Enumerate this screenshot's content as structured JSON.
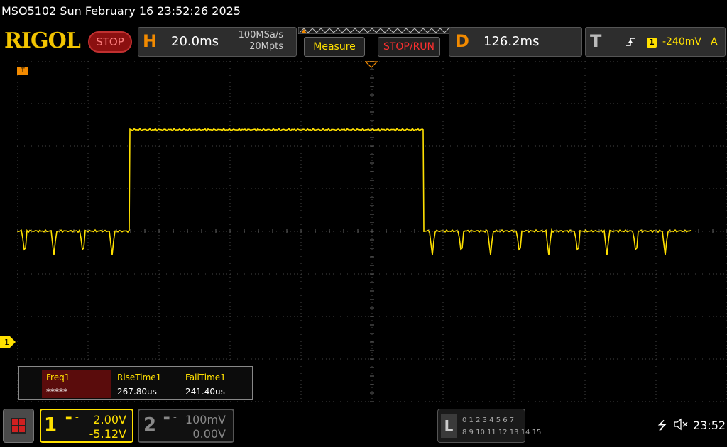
{
  "title_bar": "MSO5102  Sun February 16 23:52:26 2025",
  "logo": "RIGOL",
  "run_state": "STOP",
  "horizontal": {
    "letter": "H",
    "timebase": "20.0ms",
    "sample_rate": "100MSa/s",
    "memory_depth": "20Mpts"
  },
  "buttons": {
    "measure": "Measure",
    "stop_run": "STOP/RUN"
  },
  "delay": {
    "letter": "D",
    "value": "126.2ms"
  },
  "trigger": {
    "letter": "T",
    "edge_icon": "rising-edge-icon",
    "source": "1",
    "level": "-240mV",
    "mode": "A"
  },
  "markers": {
    "trigger_position": "T",
    "ch1_ground": "1"
  },
  "measurements": [
    {
      "name": "Freq1",
      "value": "*****"
    },
    {
      "name": "RiseTime1",
      "value": "267.80us"
    },
    {
      "name": "FallTime1",
      "value": "241.40us"
    }
  ],
  "channel1": {
    "number": "1",
    "scale": "2.00V",
    "offset": "-5.12V"
  },
  "channel2": {
    "number": "2",
    "scale": "100mV",
    "offset": "0.00V"
  },
  "logic_panel": {
    "letter": "L",
    "row1": "0 1 2 3  4 5 6 7",
    "row2": "8 9 10 11  12 13 14 15"
  },
  "status": {
    "clock": "23:52"
  },
  "colors": {
    "ch1": "#ffe000",
    "accent": "#f28a00",
    "grid": "#444444",
    "stop": "#ff3030"
  },
  "chart_data": {
    "type": "line",
    "series": [
      {
        "x_ms": [
          -110,
          -68.4,
          -68.2,
          14.4,
          14.6,
          90
        ],
        "y_v": [
          5.08,
          5.08,
          9.84,
          9.84,
          5.08,
          5.08
        ]
      }
    ]
  }
}
